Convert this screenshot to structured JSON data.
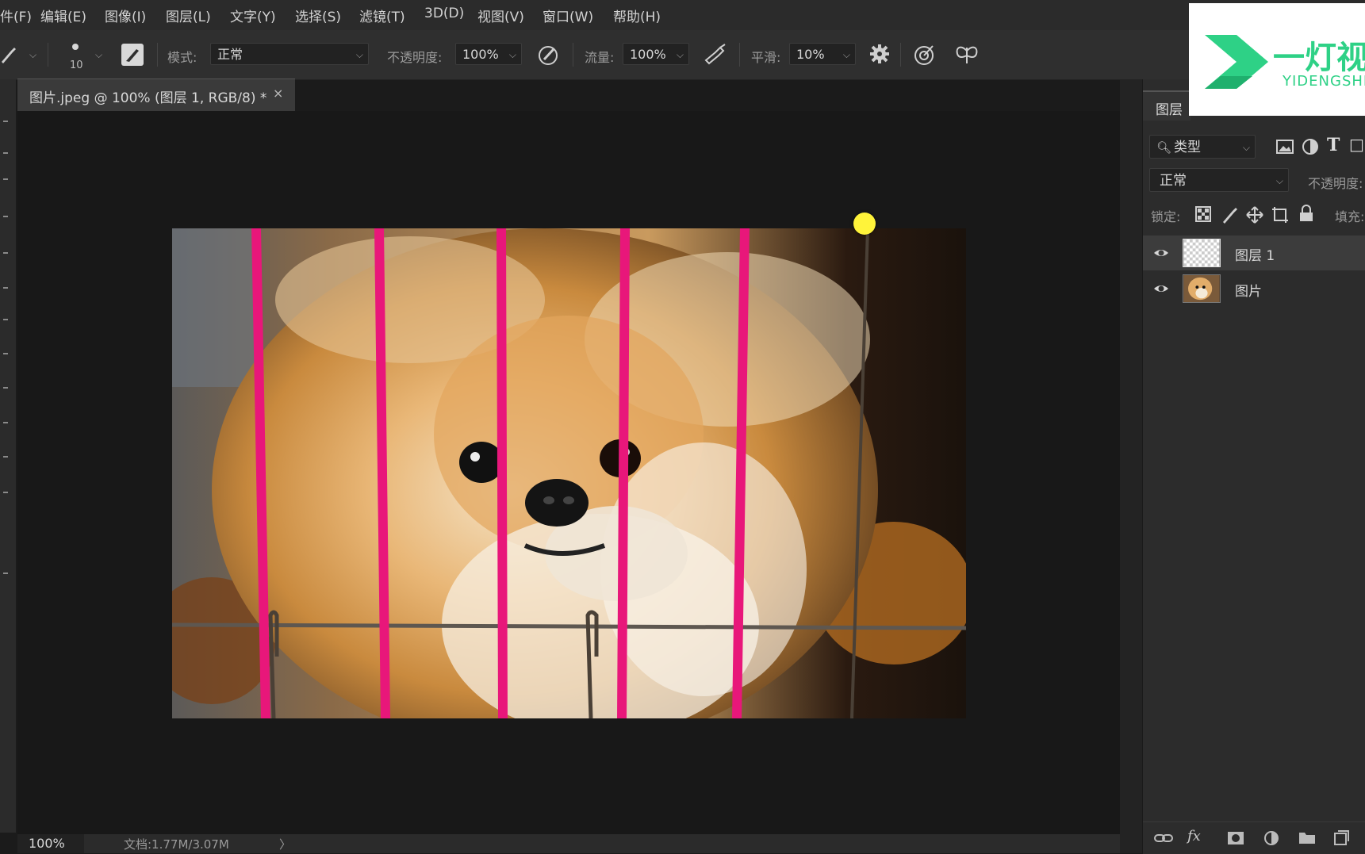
{
  "menubar": {
    "items": [
      "件(F)",
      "编辑(E)",
      "图像(I)",
      "图层(L)",
      "文字(Y)",
      "选择(S)",
      "滤镜(T)",
      "3D(D)",
      "视图(V)",
      "窗口(W)",
      "帮助(H)"
    ]
  },
  "options_bar": {
    "brush_size": "10",
    "mode_label": "模式:",
    "mode_value": "正常",
    "opacity_label": "不透明度:",
    "opacity_value": "100%",
    "flow_label": "流量:",
    "flow_value": "100%",
    "smoothing_label": "平滑:",
    "smoothing_value": "10%"
  },
  "document": {
    "tab_title": "图片.jpeg @ 100% (图层 1, RGB/8) *",
    "close_glyph": "×",
    "stroke_color": "#e8177a"
  },
  "status_bar": {
    "zoom": "100%",
    "doc_info": "文档:1.77M/3.07M",
    "arrow": "〉"
  },
  "layers_panel": {
    "tab_label": "图层",
    "filter_value": "类型",
    "blend_mode": "正常",
    "opacity_label": "不透明度:",
    "lock_label": "锁定:",
    "fill_label": "填充:",
    "layers": [
      {
        "name": "图层 1",
        "visible": true,
        "selected": true,
        "thumb": "transparent-checker"
      },
      {
        "name": "图片",
        "visible": true,
        "selected": false,
        "thumb": "dog-photo"
      }
    ],
    "footer_icons": [
      "link-icon",
      "fx-icon",
      "mask-icon",
      "adjustment-icon",
      "folder-icon",
      "new-layer-icon"
    ]
  },
  "logo": {
    "text": "一灯视",
    "subtext": "YIDENGSHI",
    "color": "#2ed186"
  },
  "cursor": {
    "color": "#fff33a"
  }
}
